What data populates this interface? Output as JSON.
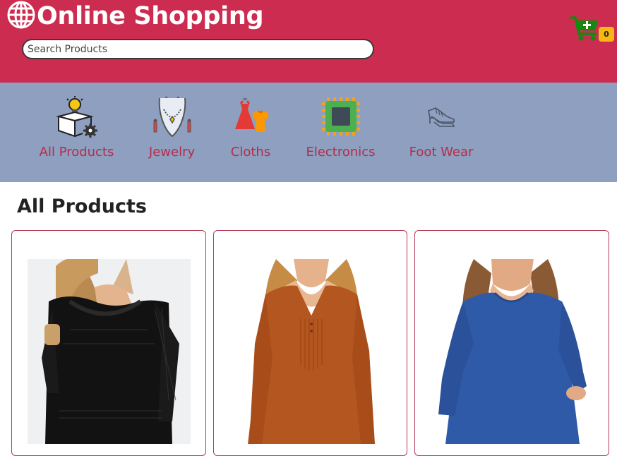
{
  "header": {
    "title": "Online Shopping",
    "logo_icon": "globe-icon",
    "search": {
      "placeholder": "Search Products",
      "value": ""
    },
    "cart": {
      "icon": "shopping-cart-plus-icon",
      "count": "0"
    }
  },
  "colors": {
    "header_bg": "#cc2c50",
    "category_bar_bg": "#8e9fbf",
    "category_label": "#b52c4b",
    "badge": "#f7b813",
    "cart_icon": "#118a0e",
    "card_border": "#b23a56"
  },
  "categories": [
    {
      "label": "All Products",
      "icon": "box-bulb-gear-icon"
    },
    {
      "label": "Jewelry",
      "icon": "necklace-icon"
    },
    {
      "label": "Cloths",
      "icon": "dress-shirt-icon"
    },
    {
      "label": "Electronics",
      "icon": "chip-icon"
    },
    {
      "label": "Foot Wear",
      "icon": "shoe-icon"
    }
  ],
  "main": {
    "section_title": "All Products",
    "products": [
      {
        "image": "black-lace-blouse-photo"
      },
      {
        "image": "rust-orange-tunic-photo"
      },
      {
        "image": "blue-long-sleeve-top-photo"
      }
    ]
  }
}
